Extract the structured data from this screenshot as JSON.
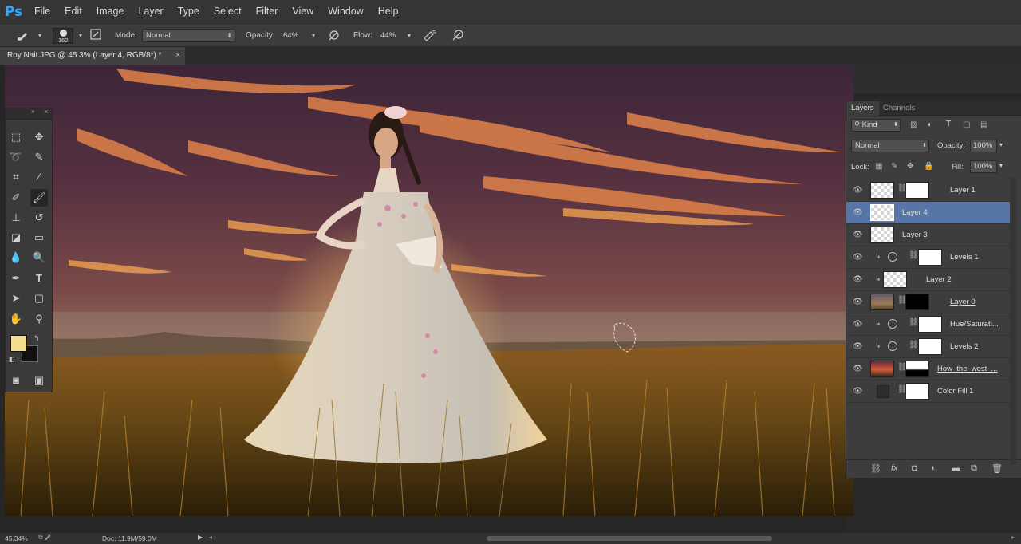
{
  "app": {
    "logo": "Ps"
  },
  "menu": [
    "File",
    "Edit",
    "Image",
    "Layer",
    "Type",
    "Select",
    "Filter",
    "View",
    "Window",
    "Help"
  ],
  "options_bar": {
    "brush_size": "162",
    "mode_label": "Mode:",
    "mode_value": "Normal",
    "opacity_label": "Opacity:",
    "opacity_value": "64%",
    "flow_label": "Flow:",
    "flow_value": "44%"
  },
  "document": {
    "tab_title": "Roy Nait.JPG @ 45.3% (Layer 4, RGB/8*) *",
    "close": "×"
  },
  "toolbox": {
    "tools": [
      "marquee-tool",
      "move-tool",
      "lasso-tool",
      "quick-selection-tool",
      "crop-tool",
      "eyedropper-tool",
      "healing-brush-tool",
      "brush-tool",
      "clone-stamp-tool",
      "history-brush-tool",
      "eraser-tool",
      "gradient-tool",
      "blur-tool",
      "dodge-tool",
      "pen-tool",
      "type-tool",
      "path-selection-tool",
      "rectangle-tool",
      "hand-tool",
      "zoom-tool"
    ],
    "foreground_color": "#f6dc8e",
    "background_color": "#111111"
  },
  "layers_panel": {
    "tabs": [
      "Layers",
      "Channels"
    ],
    "filter_kind": "Kind",
    "blend_mode": "Normal",
    "opacity_label": "Opacity:",
    "opacity_value": "100%",
    "lock_label": "Lock:",
    "fill_label": "Fill:",
    "fill_value": "100%",
    "layers": [
      {
        "name": "Layer 1",
        "clipped": false,
        "adjustment": false,
        "thumb": "checker",
        "mask": "white",
        "selected": false
      },
      {
        "name": "Layer 4",
        "clipped": false,
        "adjustment": false,
        "thumb": "checker",
        "mask": "",
        "selected": true
      },
      {
        "name": "Layer 3",
        "clipped": false,
        "adjustment": false,
        "thumb": "checker",
        "mask": "",
        "selected": false
      },
      {
        "name": "Levels 1",
        "clipped": true,
        "adjustment": true,
        "thumb": "",
        "mask": "white",
        "selected": false
      },
      {
        "name": "Layer 2",
        "clipped": true,
        "adjustment": false,
        "thumb": "checker",
        "mask": "",
        "selected": false
      },
      {
        "name": "Layer 0",
        "clipped": false,
        "adjustment": false,
        "thumb": "photo",
        "mask": "black",
        "selected": false
      },
      {
        "name": "Hue/Saturati...",
        "clipped": true,
        "adjustment": true,
        "thumb": "",
        "mask": "white",
        "selected": false
      },
      {
        "name": "Levels 2",
        "clipped": true,
        "adjustment": true,
        "thumb": "",
        "mask": "white",
        "selected": false
      },
      {
        "name": "How_the_west_...",
        "clipped": false,
        "adjustment": false,
        "thumb": "sunset",
        "mask": "gradient",
        "selected": false
      },
      {
        "name": "Color Fill 1",
        "clipped": false,
        "adjustment": false,
        "thumb": "dark",
        "mask": "white",
        "selected": false
      }
    ]
  },
  "status_bar": {
    "zoom": "45.34%",
    "doc_size": "Doc: 11.9M/59.0M"
  }
}
